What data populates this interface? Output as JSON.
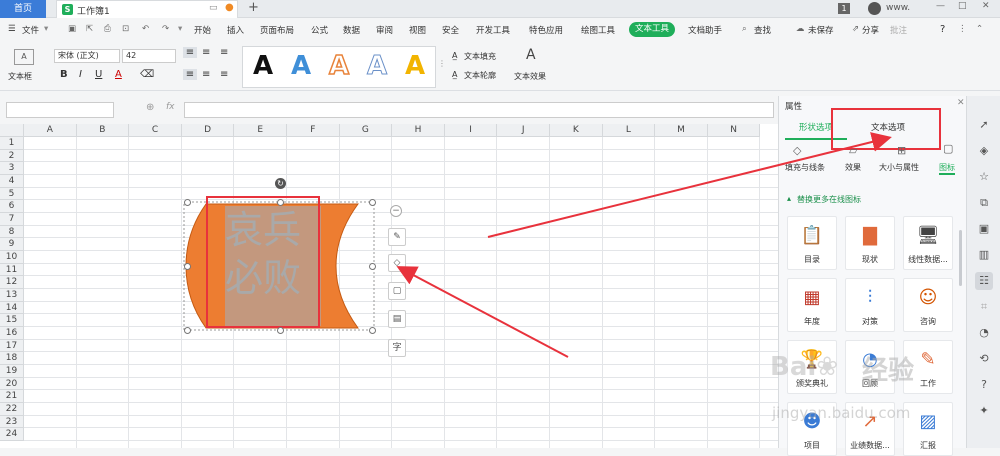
{
  "titlebar": {
    "home_tab": "首页",
    "workbook_tab": "工作簿1",
    "new_tab": "+",
    "badge": "1",
    "user_name": "www."
  },
  "menu": {
    "file": "文件",
    "items": [
      "开始",
      "插入",
      "页面布局",
      "公式",
      "数据",
      "审阅",
      "视图",
      "安全",
      "开发工具",
      "特色应用",
      "绘图工具",
      "文本工具",
      "文档助手"
    ],
    "active": "文本工具",
    "search": "查找",
    "unsaved": "未保存",
    "share": "分享",
    "comment": "批注",
    "help": "?"
  },
  "ribbon": {
    "textbox_label": "文本框",
    "font_name": "宋体 (正文)",
    "font_size": "42",
    "text_fill": "文本填充",
    "text_outline": "文本轮廓",
    "text_effect": "文本效果",
    "style_letters": [
      "A",
      "A",
      "A",
      "A",
      "A"
    ]
  },
  "formula": {
    "fx": "fx"
  },
  "columns": [
    "A",
    "B",
    "C",
    "D",
    "E",
    "F",
    "G",
    "H",
    "I",
    "J",
    "K",
    "L",
    "M",
    "N"
  ],
  "rows": [
    "1",
    "2",
    "3",
    "4",
    "5",
    "6",
    "7",
    "8",
    "9",
    "10",
    "11",
    "12",
    "13",
    "14",
    "15",
    "16",
    "17",
    "18",
    "19",
    "20",
    "21",
    "22",
    "23",
    "24"
  ],
  "shape": {
    "line1": "哀兵",
    "line2": "必败",
    "fill_color": "#ed7d31",
    "text_color": "#a9a9a9"
  },
  "float_toolbar": {
    "text_btn": "字"
  },
  "panel": {
    "title": "属性",
    "tabs": [
      "形状选项",
      "文本选项"
    ],
    "subtabs": [
      "填充与线条",
      "效果",
      "大小与属性",
      "图标"
    ],
    "active_subtab": "图标",
    "section_title": "替换更多在线图标",
    "icons": [
      {
        "label": "目录",
        "icon": "document-icon"
      },
      {
        "label": "现状",
        "icon": "bar-chart-icon"
      },
      {
        "label": "线性数据...",
        "icon": "monitor-icon"
      },
      {
        "label": "年度",
        "icon": "calendar-icon"
      },
      {
        "label": "对策",
        "icon": "sliders-icon"
      },
      {
        "label": "咨询",
        "icon": "headset-icon"
      },
      {
        "label": "颁奖典礼",
        "icon": "trophy-icon"
      },
      {
        "label": "回顾",
        "icon": "pie-chart-icon"
      },
      {
        "label": "工作",
        "icon": "pencil-icon"
      },
      {
        "label": "项目",
        "icon": "team-icon"
      },
      {
        "label": "业绩数据...",
        "icon": "line-chart-icon"
      },
      {
        "label": "汇报",
        "icon": "presentation-icon"
      }
    ]
  },
  "watermark": {
    "line1": "经验",
    "line2": "jingyan.baidu.com"
  },
  "colors": {
    "accent_green": "#1fae5a",
    "home_blue": "#3b7cd8",
    "annotation_red": "#e8323c",
    "shape_orange": "#ed7d31"
  }
}
